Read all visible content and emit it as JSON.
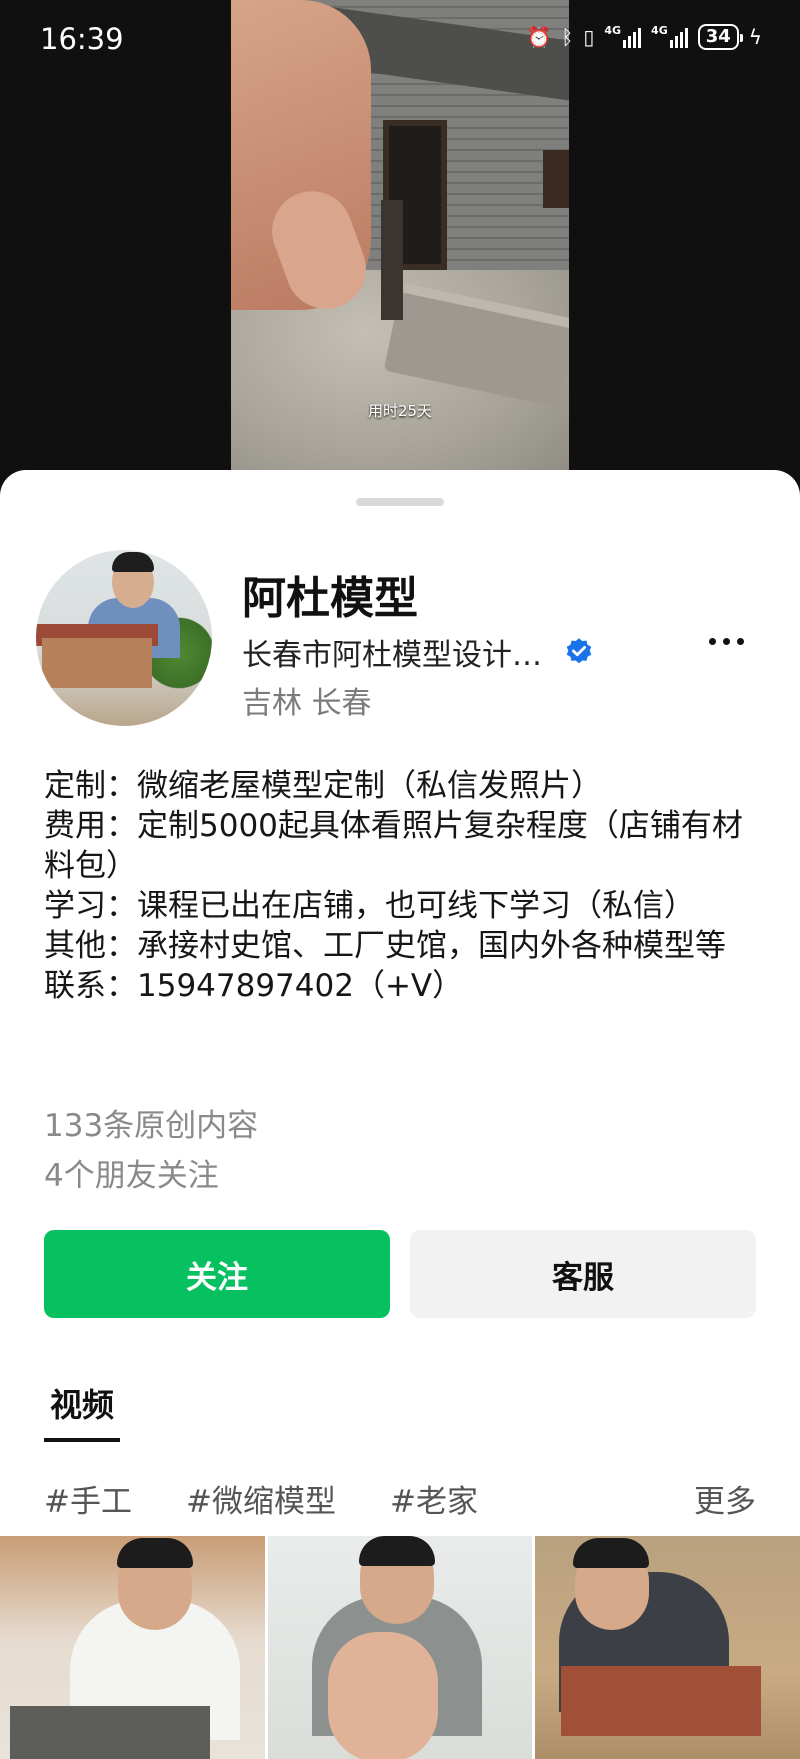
{
  "status_bar": {
    "time": "16:39",
    "network_1": "4G",
    "network_2": "4G",
    "battery": "34",
    "icons": [
      "alarm-icon",
      "bluetooth-icon",
      "vibrate-icon",
      "signal-icon",
      "signal-icon",
      "battery-icon",
      "charging-icon"
    ]
  },
  "video": {
    "caption": "用时25天"
  },
  "profile": {
    "name": "阿杜模型",
    "company": "长春市阿杜模型设计…",
    "location": "吉林 长春",
    "verified": true
  },
  "bio": {
    "line1": "定制：微缩老屋模型定制（私信发照片）",
    "line2": "费用：定制5000起具体看照片复杂程度（店铺有材料包）",
    "line3": "学习：课程已出在店铺，也可线下学习（私信）",
    "line4": "其他：承接村史馆、工厂史馆，国内外各种模型等",
    "line5": "联系：15947897402（+V）"
  },
  "stats": {
    "original_count": "133条原创内容",
    "friends_following": "4个朋友关注"
  },
  "actions": {
    "follow_label": "关注",
    "service_label": "客服"
  },
  "tabs": {
    "videos_label": "视频"
  },
  "tags": {
    "items": [
      "#手工",
      "#微缩模型",
      "#老家"
    ],
    "more_label": "更多"
  },
  "colors": {
    "follow_green": "#07c160",
    "verified_blue": "#1a73e8"
  }
}
